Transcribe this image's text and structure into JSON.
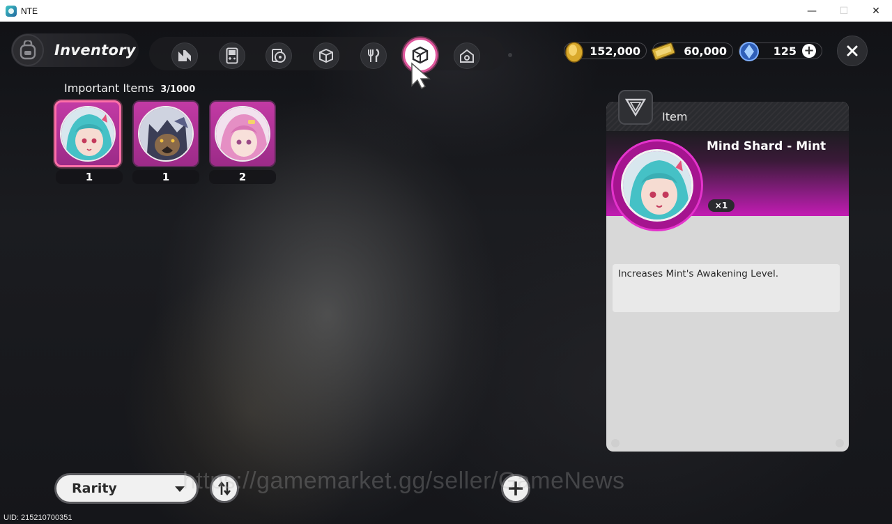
{
  "window": {
    "title": "NTE",
    "controls": [
      "minimize-icon",
      "maximize-icon",
      "close-icon"
    ]
  },
  "header": {
    "title": "Inventory",
    "categories": [
      {
        "icon": "n-logo-icon",
        "active": false
      },
      {
        "icon": "handheld-console-icon",
        "active": false
      },
      {
        "icon": "disc-case-icon",
        "active": false
      },
      {
        "icon": "box-icon",
        "active": false
      },
      {
        "icon": "fork-knife-icon",
        "active": false
      },
      {
        "icon": "cube-shard-icon",
        "active": true
      },
      {
        "icon": "house-icon",
        "active": false
      }
    ]
  },
  "currencies": [
    {
      "icon": "gold-coin-icon",
      "value": "152,000"
    },
    {
      "icon": "ticket-icon",
      "value": "60,000"
    },
    {
      "icon": "blue-crystal-icon",
      "value": "125"
    }
  ],
  "section": {
    "title": "Important Items",
    "count": "3/1000"
  },
  "items": [
    {
      "name": "Mind Shard - Mint",
      "qty": "1",
      "selected": true
    },
    {
      "name": "wolf-portrait",
      "qty": "1",
      "selected": false
    },
    {
      "name": "pink-portrait",
      "qty": "2",
      "selected": false
    }
  ],
  "detail": {
    "type_label": "Item",
    "name": "Mind Shard - Mint",
    "quantity": "×1",
    "description": "Increases Mint's Awakening Level."
  },
  "bottom": {
    "sort_label": "Rarity",
    "uid": "UID: 215210700351",
    "watermark": "https://gamemarket.gg/seller/GameNews"
  },
  "colors": {
    "accent_pink": "#e0569c",
    "item_purple": "#c23aa4",
    "detail_magenta": "#c31cb3"
  }
}
